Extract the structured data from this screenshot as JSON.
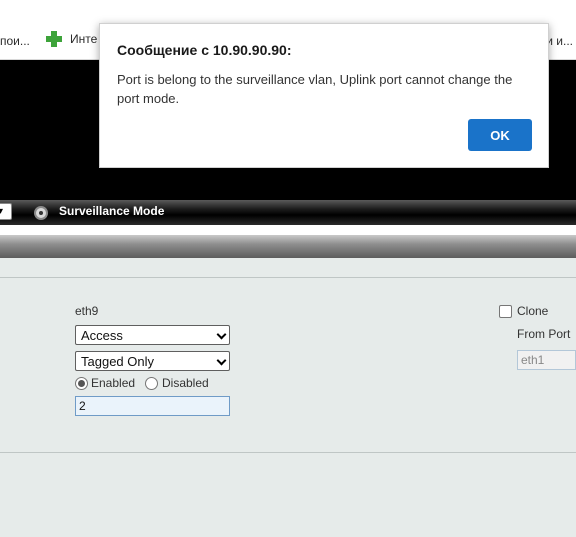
{
  "bookmarks": {
    "left": "пои...",
    "middle": "Инте",
    "right": "ки и..."
  },
  "mode_strip": {
    "selector_value": "",
    "mode_label": "Surveillance Mode",
    "icon": "camera-icon"
  },
  "form": {
    "port_name": "eth9",
    "port_mode": {
      "selected": "Access"
    },
    "frame_type": {
      "selected": "Tagged Only"
    },
    "ingress": {
      "enabled_label": "Enabled",
      "disabled_label": "Disabled",
      "selected": "Enabled"
    },
    "pvid_value": "2",
    "clone": {
      "label": "Clone",
      "checked": false
    },
    "from_port": {
      "label": "From Port",
      "value": "eth1"
    }
  },
  "dialog": {
    "title": "Сообщение с 10.90.90.90:",
    "message": "Port is belong to the surveillance vlan, Uplink port cannot change the port mode.",
    "ok_label": "OK",
    "accent": "#1a73c9"
  }
}
